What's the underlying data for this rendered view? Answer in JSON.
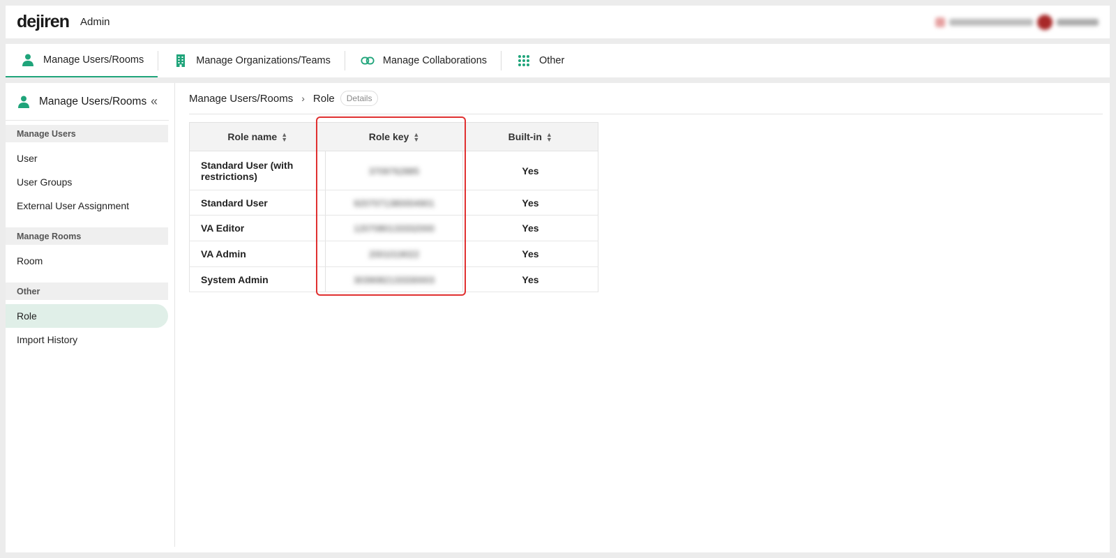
{
  "topbar": {
    "logo": "dejiren",
    "admin_label": "Admin"
  },
  "nav": {
    "tabs": [
      {
        "label": "Manage Users/Rooms",
        "icon": "person-icon"
      },
      {
        "label": "Manage Organizations/Teams",
        "icon": "building-icon"
      },
      {
        "label": "Manage Collaborations",
        "icon": "link-icon"
      },
      {
        "label": "Other",
        "icon": "grid-icon"
      }
    ]
  },
  "sidebar": {
    "title": "Manage Users/Rooms",
    "collapse_icon": "«",
    "sections": [
      {
        "header": "Manage Users",
        "items": [
          "User",
          "User Groups",
          "External User Assignment"
        ]
      },
      {
        "header": "Manage Rooms",
        "items": [
          "Room"
        ]
      },
      {
        "header": "Other",
        "items": [
          "Role",
          "Import History"
        ]
      }
    ],
    "active_item": "Role"
  },
  "breadcrumb": {
    "parent": "Manage Users/Rooms",
    "separator": "›",
    "current": "Role",
    "badge": "Details"
  },
  "table": {
    "columns": [
      "Role name",
      "Role key",
      "Built-in"
    ],
    "rows": [
      {
        "name": "Standard User (with restrictions)",
        "key": "3709762885",
        "builtin": "Yes"
      },
      {
        "name": "Standard User",
        "key": "9207071380004901",
        "builtin": "Yes"
      },
      {
        "name": "VA Editor",
        "key": "1207080133332000",
        "builtin": "Yes"
      },
      {
        "name": "VA Admin",
        "key": "2001019022",
        "builtin": "Yes"
      },
      {
        "name": "System Admin",
        "key": "3039082133330003",
        "builtin": "Yes"
      }
    ]
  },
  "colors": {
    "accent": "#1fa47a",
    "highlight": "#e03030",
    "active_bg": "#e0efe8"
  }
}
